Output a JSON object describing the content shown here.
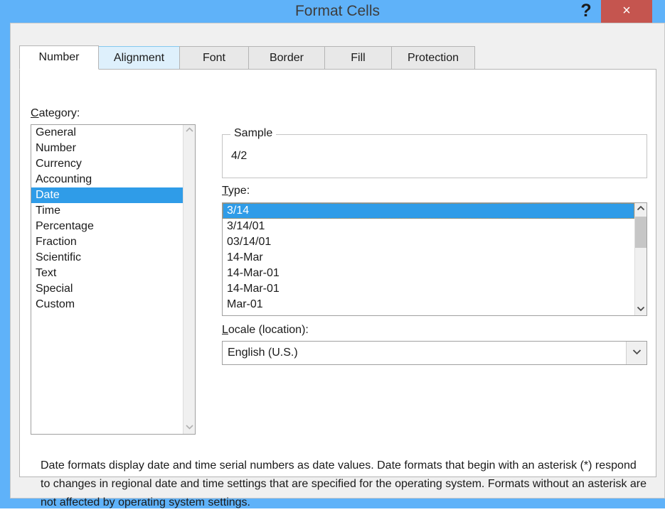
{
  "window": {
    "title": "Format Cells",
    "help_label": "?",
    "close_label": "×",
    "colors": {
      "title_bar": "#5fb2f9",
      "close_button": "#c5554f",
      "selection": "#2f9ce8",
      "tab_hover": "#def0fc",
      "dialog_background": "#f0f0f0"
    }
  },
  "tabs": [
    {
      "label": "Number",
      "state": "selected"
    },
    {
      "label": "Alignment",
      "state": "hover"
    },
    {
      "label": "Font",
      "state": "normal"
    },
    {
      "label": "Border",
      "state": "normal"
    },
    {
      "label": "Fill",
      "state": "normal"
    },
    {
      "label": "Protection",
      "state": "normal"
    }
  ],
  "category": {
    "label_accel": "C",
    "label_rest": "ategory:",
    "selected": "Date",
    "items": [
      "General",
      "Number",
      "Currency",
      "Accounting",
      "Date",
      "Time",
      "Percentage",
      "Fraction",
      "Scientific",
      "Text",
      "Special",
      "Custom"
    ]
  },
  "sample": {
    "legend": "Sample",
    "value": "4/2"
  },
  "type": {
    "label_accel": "T",
    "label_rest": "ype:",
    "selected": "3/14",
    "items": [
      "3/14",
      "3/14/01",
      "03/14/01",
      "14-Mar",
      "14-Mar-01",
      "14-Mar-01",
      "Mar-01"
    ]
  },
  "locale": {
    "label_accel": "L",
    "label_rest": "ocale (location):",
    "value": "English (U.S.)"
  },
  "description": "Date formats display date and time serial numbers as date values.  Date formats that begin with an asterisk (*) respond to changes in regional date and time settings that are specified for the operating system. Formats without an asterisk are not affected by operating system settings."
}
